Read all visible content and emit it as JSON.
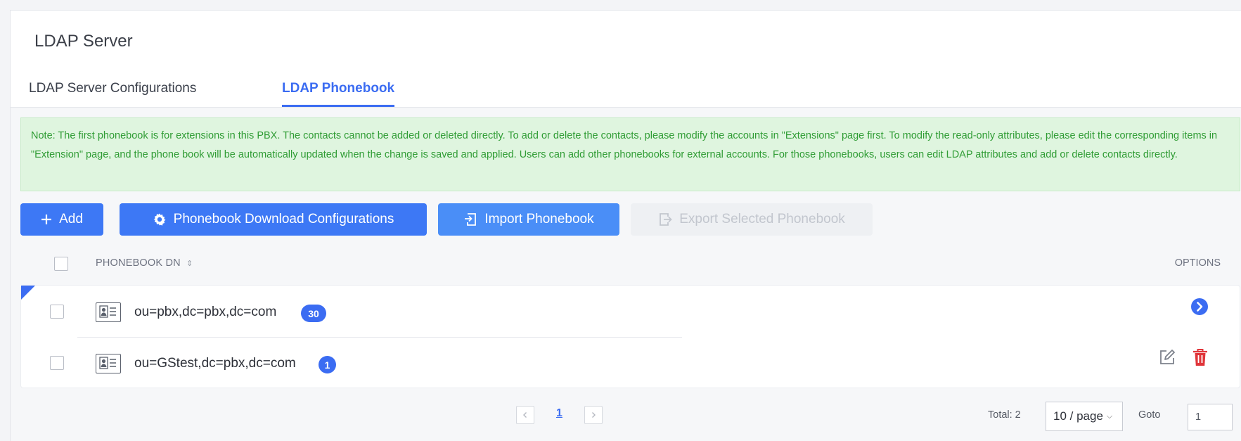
{
  "page": {
    "title": "LDAP Server"
  },
  "tabs": [
    {
      "label": "LDAP Server Configurations",
      "active": false
    },
    {
      "label": "LDAP Phonebook",
      "active": true
    }
  ],
  "note": "Note: The first phonebook is for extensions in this PBX. The contacts cannot be added or deleted directly. To add or delete the contacts, please modify the accounts in \"Extensions\" page first. To modify the read-only attributes, please edit the corresponding items in \"Extension\" page, and the phone book will be automatically updated when the change is saved and applied. Users can add other phonebooks for external accounts. For those phonebooks, users can edit LDAP attributes and add or delete contacts directly.",
  "toolbar": {
    "add_label": "Add",
    "config_label": "Phonebook Download Configurations",
    "import_label": "Import Phonebook",
    "export_label": "Export Selected Phonebook"
  },
  "table": {
    "columns": {
      "dn": "PHONEBOOK DN",
      "options": "OPTIONS"
    },
    "rows": [
      {
        "dn": "ou=pbx,dc=pbx,dc=com",
        "count": "30",
        "options": [
          "go-icon"
        ]
      },
      {
        "dn": "ou=GStest,dc=pbx,dc=com",
        "count": "1",
        "options": [
          "edit-icon",
          "delete-icon"
        ]
      }
    ]
  },
  "pagination": {
    "current_page": "1",
    "total_text": "Total: 2",
    "page_size": "10 / page",
    "goto_label": "Goto",
    "goto_value": "1"
  },
  "colors": {
    "accent": "#3b6cf2",
    "button": "#3d78f5",
    "note_bg": "#dff5df",
    "note_text": "#2f9c34",
    "delete": "#e0353a"
  }
}
